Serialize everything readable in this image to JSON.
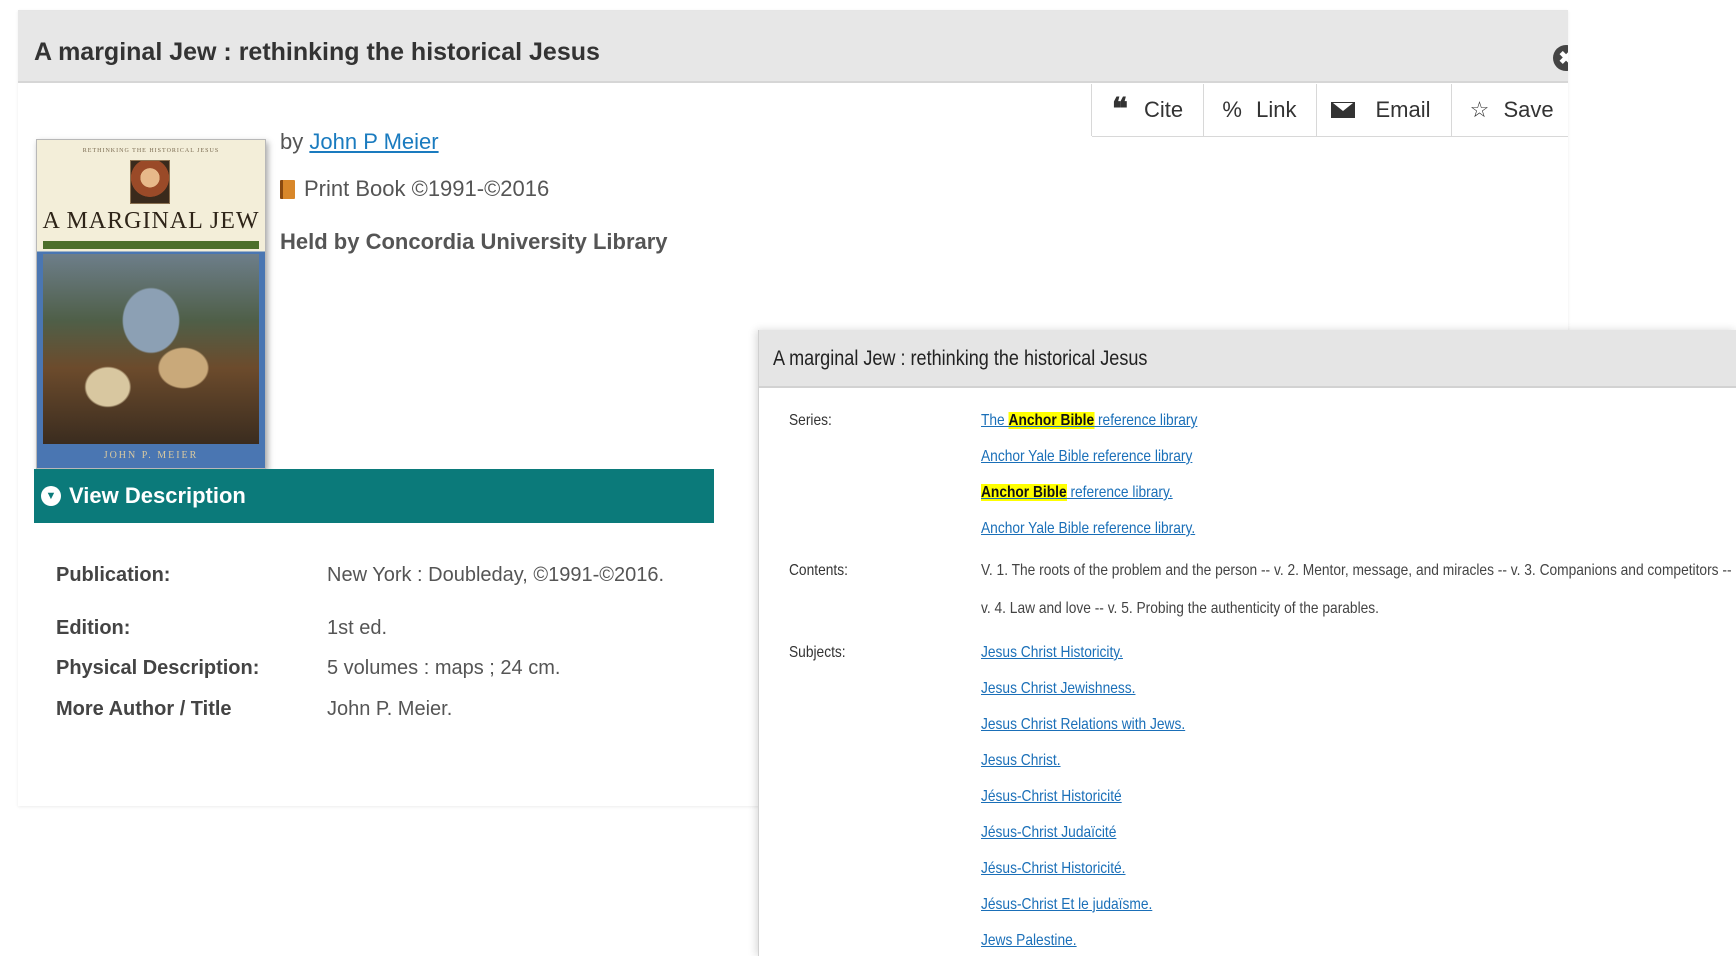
{
  "back_window": {
    "title": "A marginal Jew : rethinking the historical Jesus",
    "close_glyph": "✖",
    "actions": [
      {
        "label": "Cite",
        "icon": "quote-icon",
        "glyph": "❝"
      },
      {
        "label": "Link",
        "icon": "link-icon",
        "glyph": "%"
      },
      {
        "label": "Email",
        "icon": "envelope-icon",
        "glyph": ""
      },
      {
        "label": "Save",
        "icon": "star-icon",
        "glyph": "☆"
      }
    ],
    "cover": {
      "top_text": "RETHINKING THE HISTORICAL JESUS",
      "title": "A MARGINAL JEW",
      "author": "JOHN P. MEIER"
    },
    "by_prefix": "by",
    "author": "John P Meier",
    "format": "Print Book ©1991-©2016",
    "held_by": "Held by Concordia University Library",
    "description_toggle": "View Description",
    "details": [
      {
        "label": "Publication:",
        "value": "New York : Doubleday, ©1991-©2016."
      },
      {
        "label": "Edition:",
        "value": "1st ed."
      },
      {
        "label": "Physical Description:",
        "value": "5 volumes : maps ; 24 cm."
      },
      {
        "label": "More Author / Title",
        "value": "John P. Meier."
      }
    ]
  },
  "front_window": {
    "title": "A marginal Jew : rethinking the historical Jesus",
    "series_label": "Series:",
    "series": [
      {
        "pre": "The ",
        "highlight": "Anchor Bible",
        "post": " reference library"
      },
      {
        "pre": "Anchor Yale Bible reference library",
        "highlight": "",
        "post": ""
      },
      {
        "pre": "",
        "highlight": "Anchor Bible",
        "post": " reference library."
      },
      {
        "pre": "Anchor Yale Bible reference library.",
        "highlight": "",
        "post": ""
      }
    ],
    "contents_label": "Contents:",
    "contents": [
      "V. 1. The roots of the problem and the person -- v. 2. Mentor, message, and miracles -- v. 3. Companions and competitors --",
      "v. 4. Law and love -- v. 5. Probing the authenticity of the parables."
    ],
    "subjects_label": "Subjects:",
    "subjects": [
      "Jesus Christ Historicity.",
      "Jesus Christ Jewishness.",
      "Jesus Christ Relations with Jews.",
      "Jesus Christ.",
      "Jésus-Christ Historicité",
      "Jésus-Christ Judaïcité",
      "Jésus-Christ Historicité.",
      "Jésus-Christ Et le judaïsme.",
      "Jews Palestine."
    ],
    "highlight_color": "#ffff00",
    "link_color": "#1a6fb8"
  },
  "colors": {
    "teal_bar": "#0b7a7a",
    "author_link": "#1a7bbf"
  }
}
